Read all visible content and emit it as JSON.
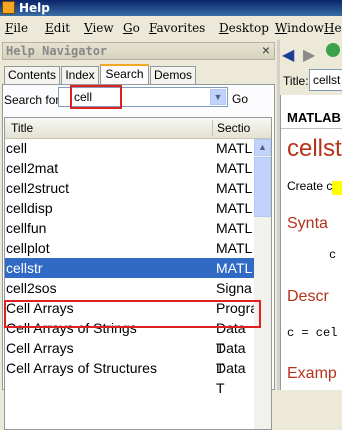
{
  "window": {
    "title": "Help"
  },
  "menu": [
    "File",
    "Edit",
    "View",
    "Go",
    "Favorites",
    "Desktop",
    "Window",
    "Help"
  ],
  "navigator": {
    "title": "Help Navigator",
    "close": "×",
    "tabs": [
      "Contents",
      "Index",
      "Search",
      "Demos"
    ],
    "active_tab": "Search",
    "search_label": "Search for:",
    "search_value": "cell",
    "go_label": "Go",
    "columns": [
      "Title",
      "Sectio"
    ],
    "rows": [
      {
        "title": "cell",
        "section": "MATL"
      },
      {
        "title": "cell2mat",
        "section": "MATL"
      },
      {
        "title": "cell2struct",
        "section": "MATL"
      },
      {
        "title": "celldisp",
        "section": "MATL"
      },
      {
        "title": "cellfun",
        "section": "MATL"
      },
      {
        "title": "cellplot",
        "section": "MATL"
      },
      {
        "title": "cellstr",
        "section": "MATL"
      },
      {
        "title": "cell2sos",
        "section": "Signa"
      },
      {
        "title": "Cell Arrays",
        "section": "Progra"
      },
      {
        "title": "Cell Arrays of Strings",
        "section": "Data T"
      },
      {
        "title": "Cell Arrays",
        "section": "Data T"
      },
      {
        "title": "Cell Arrays of Structures",
        "section": "Data T"
      }
    ],
    "selected_row": "cellstr"
  },
  "viewer": {
    "title_label": "Title:",
    "title_value": "cellst",
    "product": "MATLAB",
    "function_name": "cellst",
    "create_text": "Create c",
    "syntax_heading": "Synta",
    "syntax_code": "c",
    "description_heading": "Descr",
    "description_code": "c = cel",
    "examples_heading": "Examp"
  },
  "colors": {
    "selection": "#316ac5",
    "highlight_box": "#e02020",
    "doc_heading": "#b7321a",
    "titlebar": "#0a246a"
  }
}
